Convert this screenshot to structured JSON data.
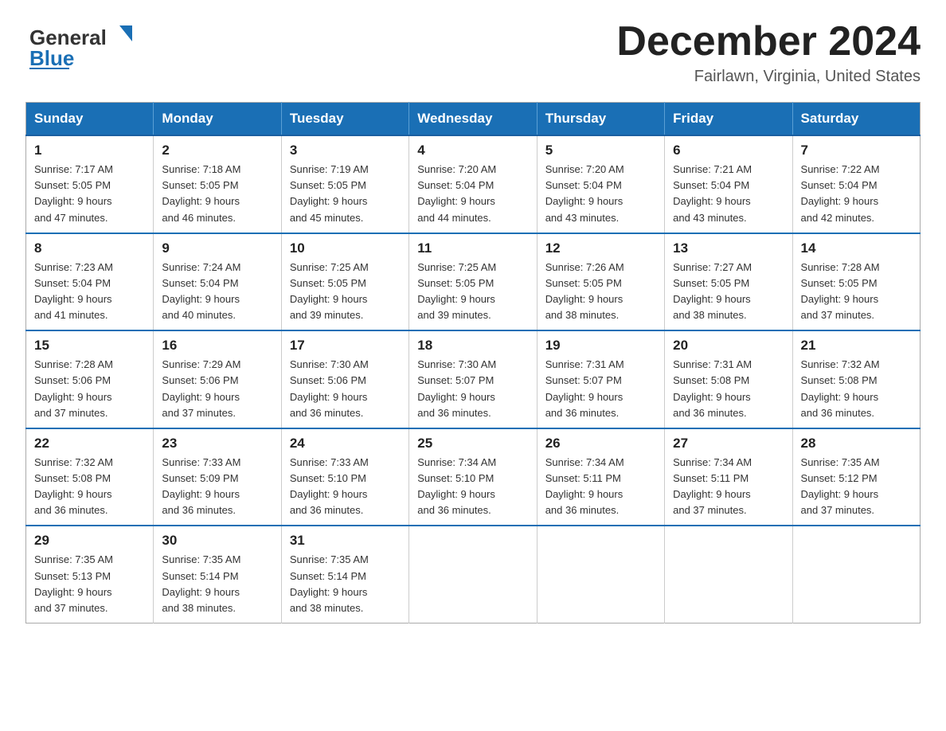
{
  "header": {
    "logo": {
      "text1": "General",
      "text2": "Blue"
    },
    "month_title": "December 2024",
    "location": "Fairlawn, Virginia, United States"
  },
  "calendar": {
    "days_of_week": [
      "Sunday",
      "Monday",
      "Tuesday",
      "Wednesday",
      "Thursday",
      "Friday",
      "Saturday"
    ],
    "weeks": [
      [
        {
          "day": "1",
          "sunrise": "7:17 AM",
          "sunset": "5:05 PM",
          "daylight": "9 hours and 47 minutes."
        },
        {
          "day": "2",
          "sunrise": "7:18 AM",
          "sunset": "5:05 PM",
          "daylight": "9 hours and 46 minutes."
        },
        {
          "day": "3",
          "sunrise": "7:19 AM",
          "sunset": "5:05 PM",
          "daylight": "9 hours and 45 minutes."
        },
        {
          "day": "4",
          "sunrise": "7:20 AM",
          "sunset": "5:04 PM",
          "daylight": "9 hours and 44 minutes."
        },
        {
          "day": "5",
          "sunrise": "7:20 AM",
          "sunset": "5:04 PM",
          "daylight": "9 hours and 43 minutes."
        },
        {
          "day": "6",
          "sunrise": "7:21 AM",
          "sunset": "5:04 PM",
          "daylight": "9 hours and 43 minutes."
        },
        {
          "day": "7",
          "sunrise": "7:22 AM",
          "sunset": "5:04 PM",
          "daylight": "9 hours and 42 minutes."
        }
      ],
      [
        {
          "day": "8",
          "sunrise": "7:23 AM",
          "sunset": "5:04 PM",
          "daylight": "9 hours and 41 minutes."
        },
        {
          "day": "9",
          "sunrise": "7:24 AM",
          "sunset": "5:04 PM",
          "daylight": "9 hours and 40 minutes."
        },
        {
          "day": "10",
          "sunrise": "7:25 AM",
          "sunset": "5:05 PM",
          "daylight": "9 hours and 39 minutes."
        },
        {
          "day": "11",
          "sunrise": "7:25 AM",
          "sunset": "5:05 PM",
          "daylight": "9 hours and 39 minutes."
        },
        {
          "day": "12",
          "sunrise": "7:26 AM",
          "sunset": "5:05 PM",
          "daylight": "9 hours and 38 minutes."
        },
        {
          "day": "13",
          "sunrise": "7:27 AM",
          "sunset": "5:05 PM",
          "daylight": "9 hours and 38 minutes."
        },
        {
          "day": "14",
          "sunrise": "7:28 AM",
          "sunset": "5:05 PM",
          "daylight": "9 hours and 37 minutes."
        }
      ],
      [
        {
          "day": "15",
          "sunrise": "7:28 AM",
          "sunset": "5:06 PM",
          "daylight": "9 hours and 37 minutes."
        },
        {
          "day": "16",
          "sunrise": "7:29 AM",
          "sunset": "5:06 PM",
          "daylight": "9 hours and 37 minutes."
        },
        {
          "day": "17",
          "sunrise": "7:30 AM",
          "sunset": "5:06 PM",
          "daylight": "9 hours and 36 minutes."
        },
        {
          "day": "18",
          "sunrise": "7:30 AM",
          "sunset": "5:07 PM",
          "daylight": "9 hours and 36 minutes."
        },
        {
          "day": "19",
          "sunrise": "7:31 AM",
          "sunset": "5:07 PM",
          "daylight": "9 hours and 36 minutes."
        },
        {
          "day": "20",
          "sunrise": "7:31 AM",
          "sunset": "5:08 PM",
          "daylight": "9 hours and 36 minutes."
        },
        {
          "day": "21",
          "sunrise": "7:32 AM",
          "sunset": "5:08 PM",
          "daylight": "9 hours and 36 minutes."
        }
      ],
      [
        {
          "day": "22",
          "sunrise": "7:32 AM",
          "sunset": "5:08 PM",
          "daylight": "9 hours and 36 minutes."
        },
        {
          "day": "23",
          "sunrise": "7:33 AM",
          "sunset": "5:09 PM",
          "daylight": "9 hours and 36 minutes."
        },
        {
          "day": "24",
          "sunrise": "7:33 AM",
          "sunset": "5:10 PM",
          "daylight": "9 hours and 36 minutes."
        },
        {
          "day": "25",
          "sunrise": "7:34 AM",
          "sunset": "5:10 PM",
          "daylight": "9 hours and 36 minutes."
        },
        {
          "day": "26",
          "sunrise": "7:34 AM",
          "sunset": "5:11 PM",
          "daylight": "9 hours and 36 minutes."
        },
        {
          "day": "27",
          "sunrise": "7:34 AM",
          "sunset": "5:11 PM",
          "daylight": "9 hours and 37 minutes."
        },
        {
          "day": "28",
          "sunrise": "7:35 AM",
          "sunset": "5:12 PM",
          "daylight": "9 hours and 37 minutes."
        }
      ],
      [
        {
          "day": "29",
          "sunrise": "7:35 AM",
          "sunset": "5:13 PM",
          "daylight": "9 hours and 37 minutes."
        },
        {
          "day": "30",
          "sunrise": "7:35 AM",
          "sunset": "5:14 PM",
          "daylight": "9 hours and 38 minutes."
        },
        {
          "day": "31",
          "sunrise": "7:35 AM",
          "sunset": "5:14 PM",
          "daylight": "9 hours and 38 minutes."
        },
        null,
        null,
        null,
        null
      ]
    ]
  }
}
